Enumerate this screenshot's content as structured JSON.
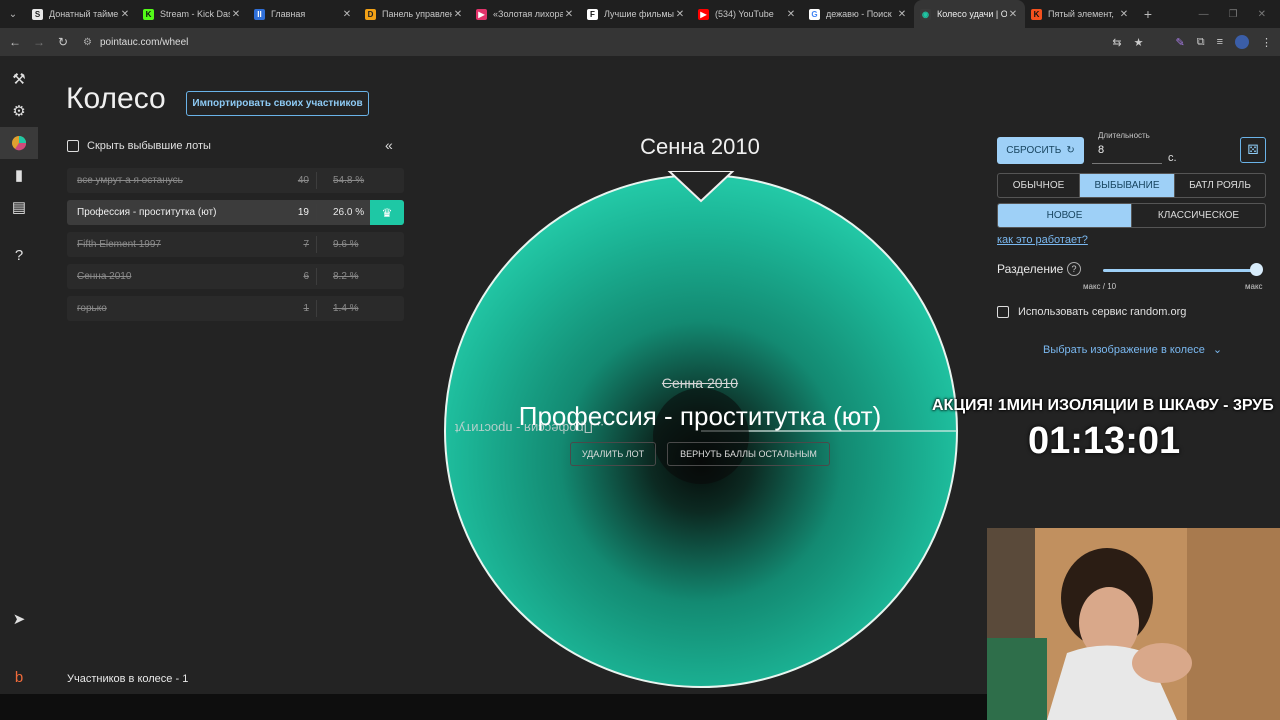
{
  "browser": {
    "tabs": [
      {
        "label": "Донатный таймер",
        "icon_letter": "S",
        "icon_color": "#e8e8e8",
        "icon_text_color": "#1f1f1f",
        "active": false
      },
      {
        "label": "Stream - Kick Das",
        "icon_letter": "K",
        "icon_color": "#53fc18",
        "icon_text_color": "#111111",
        "active": false
      },
      {
        "label": "Главная",
        "icon_letter": "II",
        "icon_color": "#2f6fd8",
        "icon_text_color": "#ffffff",
        "active": false
      },
      {
        "label": "Панель управлен",
        "icon_letter": "D",
        "icon_color": "#f2a116",
        "icon_text_color": "#222222",
        "active": false
      },
      {
        "label": "«Золотая лихорад",
        "icon_letter": "▶",
        "icon_color": "#e2336b",
        "icon_text_color": "#ffffff",
        "active": false
      },
      {
        "label": "Лучшие фильмы",
        "icon_letter": "F",
        "icon_color": "#ffffff",
        "icon_text_color": "#111111",
        "active": false
      },
      {
        "label": "(534) YouTube",
        "icon_letter": "▶",
        "icon_color": "#ff0000",
        "icon_text_color": "#ffffff",
        "active": false
      },
      {
        "label": "дежавю - Поиск",
        "icon_letter": "G",
        "icon_color": "#ffffff",
        "icon_text_color": "#4285f4",
        "active": false
      },
      {
        "label": "Колесо удачи | О",
        "icon_letter": "◉",
        "icon_color": "#3a3a3a",
        "icon_text_color": "#1ec8a5",
        "active": true
      },
      {
        "label": "Пятый элемент, ",
        "icon_letter": "K",
        "icon_color": "#f5511e",
        "icon_text_color": "#111111",
        "active": false
      }
    ],
    "url": "pointauc.com/wheel"
  },
  "page": {
    "title": "Колесо",
    "import_button": "Импортировать своих участников",
    "hide_checkbox_label": "Скрыть выбывшие лоты",
    "collapse_glyph": "«",
    "participants_count": "Участников в колесе - 1"
  },
  "lots": [
    {
      "name": "все умрут а я останусь",
      "value": "40",
      "percent": "54.8 %",
      "eliminated": true
    },
    {
      "name": "Профессия - проститутка (ют)",
      "value": "19",
      "percent": "26.0 %",
      "eliminated": false
    },
    {
      "name": "Fifth Element 1997",
      "value": "7",
      "percent": "9.6 %",
      "eliminated": true
    },
    {
      "name": "Сенна 2010",
      "value": "6",
      "percent": "8.2 %",
      "eliminated": true
    },
    {
      "name": "горько",
      "value": "1",
      "percent": "1.4 %",
      "eliminated": true
    }
  ],
  "wheel": {
    "top_label": "Сенна 2010",
    "center_eliminated": "Сенна 2010",
    "center_winner": "Профессия - проститутка (ют)",
    "mirrored_label": "...Профессия - проституt",
    "delete_button": "УДАЛИТЬ ЛОТ",
    "return_button": "ВЕРНУТЬ БАЛЛЫ ОСТАЛЬНЫМ",
    "accent_color": "#1ec8a5"
  },
  "controls": {
    "reset_button": "СБРОСИТЬ",
    "duration_label": "Длительность",
    "duration_value": "8",
    "duration_unit": "с.",
    "mode_options": [
      "ОБЫЧНОЕ",
      "ВЫБЫВАНИЕ",
      "БАТЛ РОЯЛЬ"
    ],
    "mode_selected": 1,
    "style_options": [
      "НОВОЕ",
      "КЛАССИЧЕСКОЕ"
    ],
    "style_selected": 0,
    "how_it_works": "как это работает?",
    "split_label": "Разделение",
    "split_min_label": "макс / 10",
    "split_max_label": "макс",
    "split_level": 1.0,
    "random_org_label": "Использовать сервис random.org",
    "pick_image_label": "Выбрать изображение в колесе"
  },
  "overlay": {
    "promo": "АКЦИЯ! 1МИН ИЗОЛЯЦИИ В ШКАФУ - 3РУБ",
    "timer": "01:13:01"
  }
}
